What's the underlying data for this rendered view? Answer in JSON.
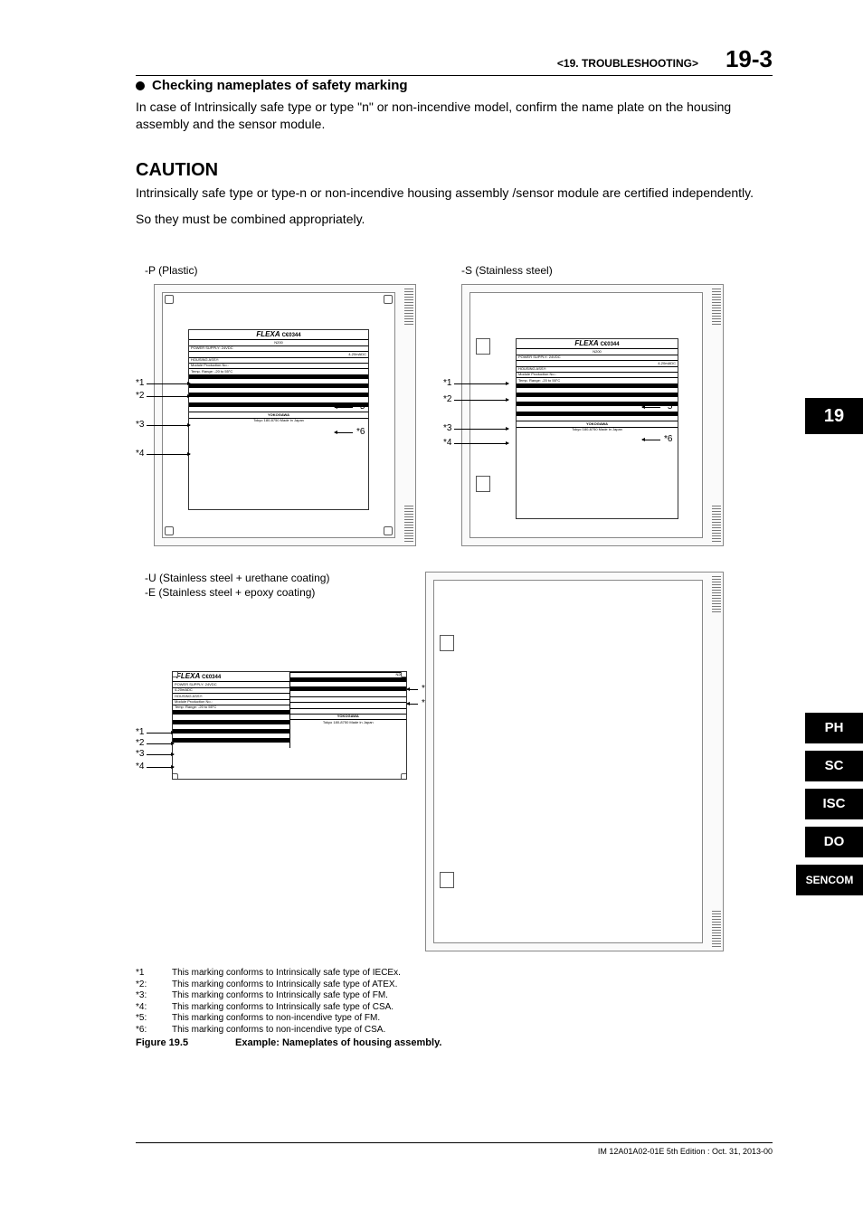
{
  "header": {
    "section": "<19.  TROUBLESHOOTING>",
    "page": "19-3"
  },
  "section": {
    "bullet_title": "Checking nameplates of safety marking",
    "para1": "In case of Intrinsically safe type or type \"n\" or non-incendive model, confirm the name plate on the housing assembly and the sensor module.",
    "caution": "CAUTION",
    "caution_p1": "Intrinsically safe type or type-n or non-incendive housing assembly /sensor module are certified independently.",
    "caution_p2": "So they must be combined appropriately."
  },
  "figure": {
    "label_p": "-P (Plastic)",
    "label_s": "-S (Stainless steel)",
    "label_ue1": "-U (Stainless steel + urethane coating)",
    "label_ue2": "-E (Stainless steel + epoxy coating)",
    "pointer_labels": {
      "p1": "*1",
      "p2": "*2",
      "p3": "*3",
      "p4": "*4",
      "p5": "*5",
      "p6": "*6"
    },
    "nameplate": {
      "brand": "FLEXA",
      "ce": "C€0344",
      "n200": "N200",
      "power": "POWER SUPPLY: 24VDC",
      "current": "4-20mADC",
      "housing": "HOUSING ASSY:",
      "module": "Module Production No.:",
      "temp": "Temp. Range: -20 to 55°C",
      "mfg": "YOKOGAWA",
      "addr": "Tokyo 180-8750 Made in Japan"
    }
  },
  "footnotes": [
    {
      "k": "*1",
      "v": "This marking conforms to Intrinsically safe type of IECEx."
    },
    {
      "k": "*2:",
      "v": "This marking conforms to Intrinsically safe type of ATEX."
    },
    {
      "k": "*3:",
      "v": "This marking conforms to Intrinsically safe type of FM."
    },
    {
      "k": "*4:",
      "v": "This marking conforms to Intrinsically safe type of CSA."
    },
    {
      "k": "*5:",
      "v": "This marking conforms to non-incendive type of FM."
    },
    {
      "k": "*6:",
      "v": "This marking conforms to non-incendive type of CSA."
    }
  ],
  "figure_caption": {
    "left": "Figure 19.5",
    "right": "Example: Nameplates of housing assembly."
  },
  "tabs": {
    "t19": "19",
    "ph": "PH",
    "sc": "SC",
    "isc": "ISC",
    "do_": "DO",
    "sencom": "SENCOM"
  },
  "footer": "IM 12A01A02-01E     5th Edition : Oct. 31, 2013-00"
}
